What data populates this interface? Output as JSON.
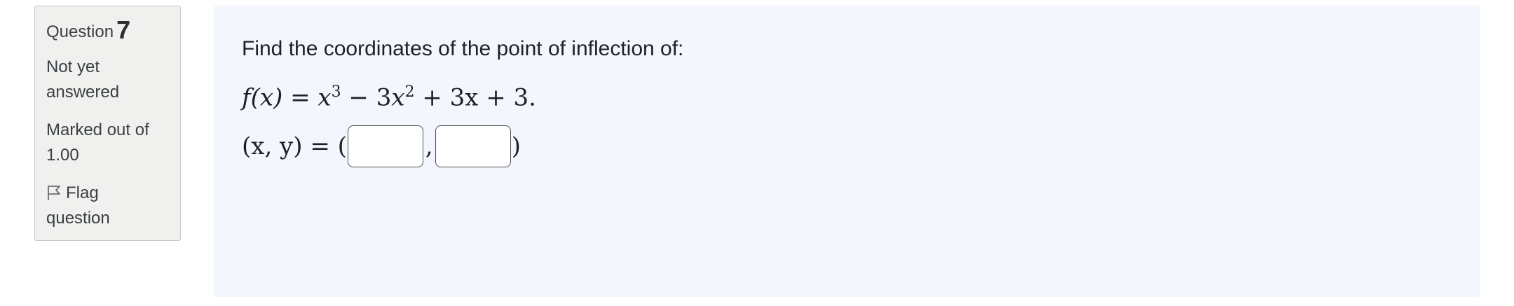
{
  "info": {
    "question_label": "Question",
    "question_number": "7",
    "state_line1": "Not yet",
    "state_line2": "answered",
    "grade_line1": "Marked out of",
    "grade_line2": "1.00",
    "flag_line1": "Flag",
    "flag_line2": "question",
    "flag_icon": "flag-icon"
  },
  "question": {
    "prompt": "Find the coordinates of the point of inflection of:",
    "formula_lhs": "f(x) = ",
    "formula_term1_base": "x",
    "formula_term1_exp": "3",
    "formula_op1": " − 3",
    "formula_term2_base": "x",
    "formula_term2_exp": "2",
    "formula_rest": " + 3x + 3.",
    "answer_lhs": "(x, y) = (",
    "answer_comma": ",",
    "answer_close": ")",
    "answer_x_value": "",
    "answer_y_value": ""
  },
  "colors": {
    "info_bg": "#f0f0ef",
    "content_bg": "#f3f7fd",
    "text": "#1d2125"
  }
}
